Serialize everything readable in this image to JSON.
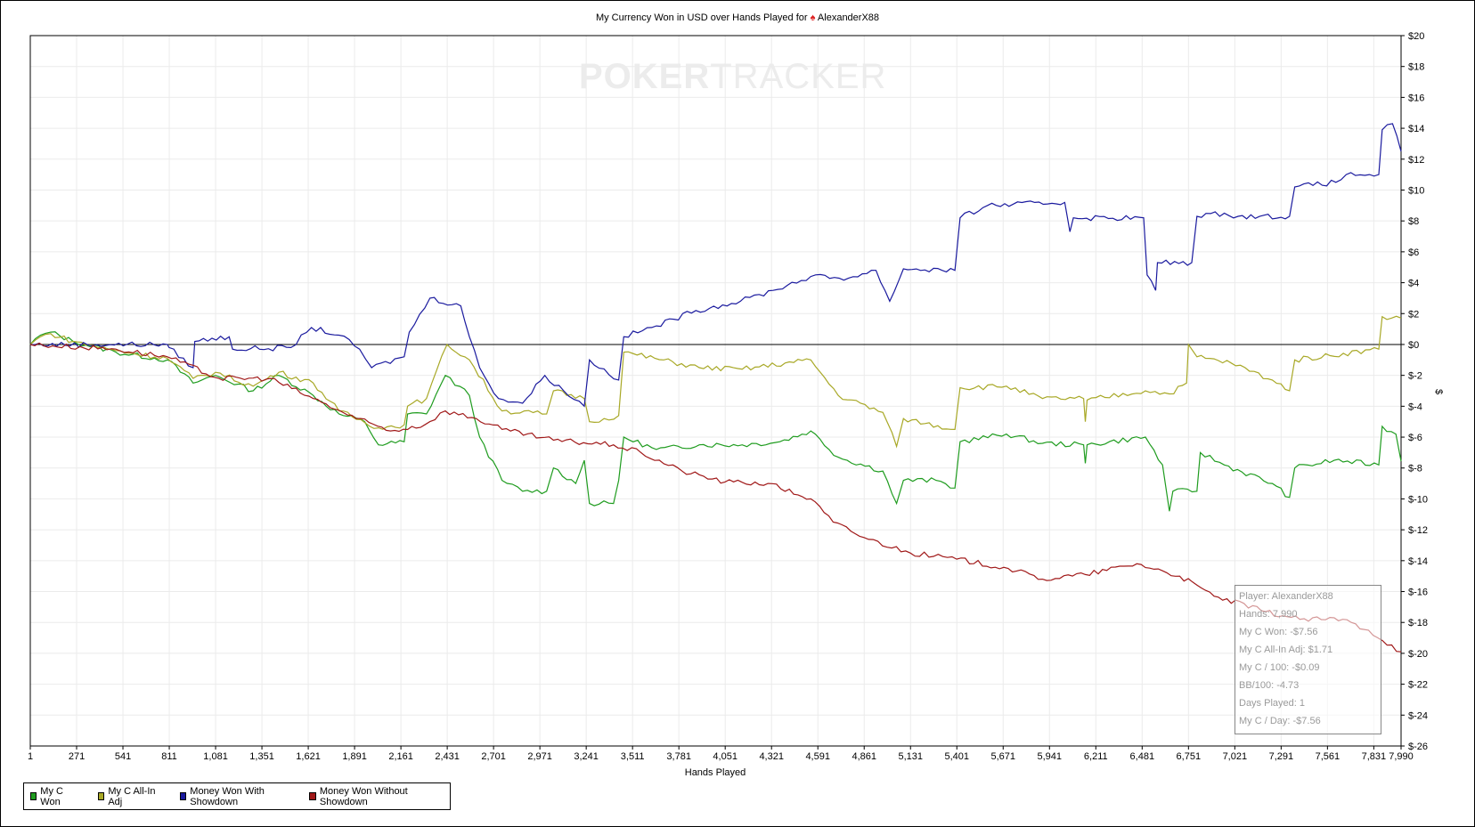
{
  "chart_data": {
    "type": "line",
    "title": "My Currency Won in USD over Hands Played for",
    "player": "AlexanderX88",
    "xlabel": "Hands Played",
    "ylabel": "$",
    "xlim": [
      1,
      7990
    ],
    "ylim": [
      -26,
      20
    ],
    "grid": true,
    "legend_position": "bottom-left",
    "x_ticks": [
      1,
      271,
      541,
      811,
      1081,
      1351,
      1621,
      1891,
      2161,
      2431,
      2701,
      2971,
      3241,
      3511,
      3781,
      4051,
      4321,
      4591,
      4861,
      5131,
      5401,
      5671,
      5941,
      6211,
      6481,
      6751,
      7021,
      7291,
      7561,
      7831,
      7990
    ],
    "x_tick_labels": [
      "1",
      "271",
      "541",
      "811",
      "1,081",
      "1,351",
      "1,621",
      "1,891",
      "2,161",
      "2,431",
      "2,701",
      "2,971",
      "3,241",
      "3,511",
      "3,781",
      "4,051",
      "4,321",
      "4,591",
      "4,861",
      "5,131",
      "5,401",
      "5,671",
      "5,941",
      "6,211",
      "6,481",
      "6,751",
      "7,021",
      "7,291",
      "7,561",
      "7,831",
      "7,990"
    ],
    "y_ticks": [
      20,
      18,
      16,
      14,
      12,
      10,
      8,
      6,
      4,
      2,
      0,
      -2,
      -4,
      -6,
      -8,
      -10,
      -12,
      -14,
      -16,
      -18,
      -20,
      -22,
      -24,
      -26
    ],
    "y_tick_labels": [
      "$20",
      "$18",
      "$16",
      "$14",
      "$12",
      "$10",
      "$8",
      "$6",
      "$4",
      "$2",
      "$0",
      "$-2",
      "$-4",
      "$-6",
      "$-8",
      "$-10",
      "$-12",
      "$-14",
      "$-16",
      "$-18",
      "$-20",
      "$-22",
      "$-24",
      "$-26"
    ],
    "series": [
      {
        "name": "My C Won",
        "color": "#1f9c1f",
        "points": [
          [
            1,
            0
          ],
          [
            60,
            0.6
          ],
          [
            120,
            0.8
          ],
          [
            250,
            0.2
          ],
          [
            500,
            -0.5
          ],
          [
            800,
            -1.0
          ],
          [
            950,
            -2.5
          ],
          [
            1080,
            -2
          ],
          [
            1300,
            -3
          ],
          [
            1450,
            -2
          ],
          [
            1650,
            -3.3
          ],
          [
            1800,
            -4.5
          ],
          [
            1950,
            -5
          ],
          [
            2030,
            -6.5
          ],
          [
            2180,
            -6.3
          ],
          [
            2200,
            -4.5
          ],
          [
            2310,
            -4.5
          ],
          [
            2420,
            -2
          ],
          [
            2560,
            -3.3
          ],
          [
            2620,
            -6
          ],
          [
            2750,
            -8.8
          ],
          [
            2870,
            -9.5
          ],
          [
            3010,
            -9.5
          ],
          [
            3050,
            -8
          ],
          [
            3180,
            -9
          ],
          [
            3230,
            -7.5
          ],
          [
            3260,
            -10.3
          ],
          [
            3400,
            -10.3
          ],
          [
            3430,
            -8.8
          ],
          [
            3460,
            -6
          ],
          [
            3650,
            -6.8
          ],
          [
            3900,
            -6.5
          ],
          [
            4150,
            -6.5
          ],
          [
            4370,
            -6.3
          ],
          [
            4550,
            -5.6
          ],
          [
            4710,
            -7.3
          ],
          [
            4970,
            -8.2
          ],
          [
            5050,
            -10.3
          ],
          [
            5090,
            -8.8
          ],
          [
            5280,
            -8.8
          ],
          [
            5390,
            -9.3
          ],
          [
            5420,
            -6.3
          ],
          [
            5690,
            -5.8
          ],
          [
            5900,
            -6.4
          ],
          [
            6140,
            -6.5
          ],
          [
            6150,
            -7.7
          ],
          [
            6160,
            -6.5
          ],
          [
            6500,
            -6
          ],
          [
            6600,
            -7.8
          ],
          [
            6640,
            -10.8
          ],
          [
            6660,
            -9.5
          ],
          [
            6800,
            -9.5
          ],
          [
            6820,
            -7
          ],
          [
            6960,
            -7.8
          ],
          [
            7240,
            -9
          ],
          [
            7340,
            -9.9
          ],
          [
            7370,
            -8
          ],
          [
            7600,
            -7.5
          ],
          [
            7860,
            -7.8
          ],
          [
            7880,
            -5.3
          ],
          [
            7960,
            -5.8
          ],
          [
            7990,
            -7.56
          ]
        ]
      },
      {
        "name": "My C All-In Adj",
        "color": "#a8a826",
        "points": [
          [
            1,
            0
          ],
          [
            60,
            0.5
          ],
          [
            120,
            0.7
          ],
          [
            250,
            0.2
          ],
          [
            500,
            -0.4
          ],
          [
            800,
            -0.9
          ],
          [
            950,
            -2.2
          ],
          [
            1080,
            -1.8
          ],
          [
            1300,
            -2.7
          ],
          [
            1450,
            -1.8
          ],
          [
            1650,
            -2.5
          ],
          [
            1800,
            -4.3
          ],
          [
            2030,
            -5.4
          ],
          [
            2180,
            -5.2
          ],
          [
            2200,
            -4
          ],
          [
            2310,
            -3.5
          ],
          [
            2430,
            0
          ],
          [
            2560,
            -1
          ],
          [
            2750,
            -4.3
          ],
          [
            3010,
            -4.5
          ],
          [
            3050,
            -3
          ],
          [
            3230,
            -3.5
          ],
          [
            3260,
            -5
          ],
          [
            3430,
            -4.6
          ],
          [
            3460,
            -0.5
          ],
          [
            3900,
            -1.5
          ],
          [
            4150,
            -1.6
          ],
          [
            4550,
            -1
          ],
          [
            4710,
            -3.3
          ],
          [
            4970,
            -4.4
          ],
          [
            5050,
            -6.6
          ],
          [
            5090,
            -4.8
          ],
          [
            5390,
            -5.5
          ],
          [
            5420,
            -2.8
          ],
          [
            5690,
            -2.7
          ],
          [
            5900,
            -3.5
          ],
          [
            6140,
            -3.5
          ],
          [
            6150,
            -5
          ],
          [
            6160,
            -3.6
          ],
          [
            6500,
            -3
          ],
          [
            6640,
            -3.2
          ],
          [
            6740,
            -2.5
          ],
          [
            6751,
            0
          ],
          [
            6800,
            -0.8
          ],
          [
            7000,
            -1.2
          ],
          [
            7240,
            -2.3
          ],
          [
            7340,
            -3
          ],
          [
            7370,
            -1
          ],
          [
            7860,
            -0.3
          ],
          [
            7880,
            1.8
          ],
          [
            7990,
            1.71
          ]
        ]
      },
      {
        "name": "Money Won With Showdown",
        "color": "#1a1a9e",
        "points": [
          [
            1,
            0
          ],
          [
            800,
            0
          ],
          [
            810,
            -0.2
          ],
          [
            950,
            -1.5
          ],
          [
            960,
            0.2
          ],
          [
            1160,
            0.5
          ],
          [
            1180,
            -0.3
          ],
          [
            1520,
            -0.2
          ],
          [
            1640,
            1.1
          ],
          [
            1800,
            0.6
          ],
          [
            1920,
            -0.3
          ],
          [
            1990,
            -1.5
          ],
          [
            2180,
            -0.8
          ],
          [
            2210,
            0.8
          ],
          [
            2330,
            3
          ],
          [
            2510,
            2.5
          ],
          [
            2560,
            0.5
          ],
          [
            2620,
            -1.5
          ],
          [
            2730,
            -3.5
          ],
          [
            2870,
            -3.8
          ],
          [
            3000,
            -2
          ],
          [
            3110,
            -3
          ],
          [
            3230,
            -4
          ],
          [
            3260,
            -1
          ],
          [
            3430,
            -2.3
          ],
          [
            3460,
            0.5
          ],
          [
            3650,
            1.2
          ],
          [
            3880,
            2.2
          ],
          [
            4140,
            2.8
          ],
          [
            4330,
            3.5
          ],
          [
            4550,
            4.4
          ],
          [
            4770,
            4.3
          ],
          [
            4930,
            4.8
          ],
          [
            5010,
            2.8
          ],
          [
            5090,
            4.9
          ],
          [
            5390,
            4.8
          ],
          [
            5420,
            8.2
          ],
          [
            5580,
            9
          ],
          [
            6030,
            9.2
          ],
          [
            6060,
            7.3
          ],
          [
            6080,
            8.2
          ],
          [
            6490,
            8.2
          ],
          [
            6510,
            4.5
          ],
          [
            6560,
            3.5
          ],
          [
            6570,
            5.3
          ],
          [
            6770,
            5.3
          ],
          [
            6800,
            8.3
          ],
          [
            6960,
            8.5
          ],
          [
            7040,
            8.3
          ],
          [
            7340,
            8.3
          ],
          [
            7370,
            10.2
          ],
          [
            7610,
            10.5
          ],
          [
            7670,
            11
          ],
          [
            7860,
            11
          ],
          [
            7880,
            13.9
          ],
          [
            7940,
            14.3
          ],
          [
            7990,
            12.5
          ]
        ]
      },
      {
        "name": "Money Won Without Showdown",
        "color": "#a01818",
        "points": [
          [
            1,
            0
          ],
          [
            500,
            -0.3
          ],
          [
            800,
            -0.8
          ],
          [
            1100,
            -2.2
          ],
          [
            1400,
            -2.2
          ],
          [
            1650,
            -3.5
          ],
          [
            1900,
            -4.8
          ],
          [
            2100,
            -5.6
          ],
          [
            2300,
            -5.2
          ],
          [
            2420,
            -4.3
          ],
          [
            2600,
            -4.8
          ],
          [
            2750,
            -5.5
          ],
          [
            3050,
            -6.2
          ],
          [
            3400,
            -6.5
          ],
          [
            3560,
            -7
          ],
          [
            3800,
            -8.2
          ],
          [
            4050,
            -8.9
          ],
          [
            4300,
            -9
          ],
          [
            4550,
            -10
          ],
          [
            4680,
            -11.5
          ],
          [
            4860,
            -12.5
          ],
          [
            5130,
            -13.5
          ],
          [
            5400,
            -13.9
          ],
          [
            5700,
            -14.5
          ],
          [
            5900,
            -15.2
          ],
          [
            6150,
            -14.9
          ],
          [
            6450,
            -14.2
          ],
          [
            6700,
            -15
          ],
          [
            6900,
            -16.3
          ],
          [
            7200,
            -17.3
          ],
          [
            7400,
            -17.8
          ],
          [
            7650,
            -17.8
          ],
          [
            7800,
            -18.5
          ],
          [
            7990,
            -19.9
          ]
        ]
      }
    ],
    "watermark": {
      "bold": "POKER",
      "light": "TRACKER"
    }
  },
  "tooltip": [
    "Player: AlexanderX88",
    "Hands: 7,990",
    "My C Won: -$7.56",
    "My C All-In Adj: $1.71",
    "My C / 100: -$0.09",
    "BB/100: -4.73",
    "Days Played: 1",
    "My C / Day: -$7.56"
  ]
}
